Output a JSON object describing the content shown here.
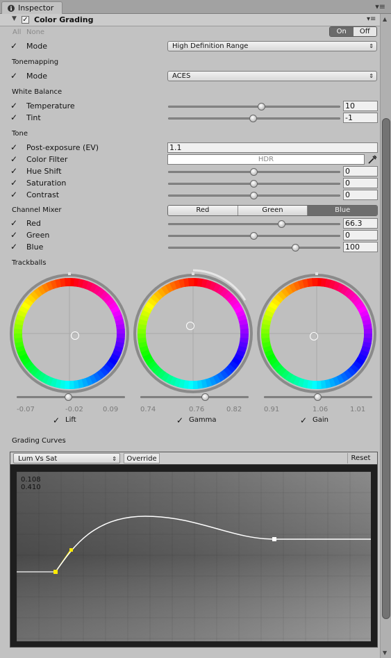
{
  "tab": {
    "title": "Inspector",
    "icon": "info-icon",
    "menu_icon": "▾≡"
  },
  "header": {
    "title": "Color Grading",
    "menu_icon": "▾≡"
  },
  "toggle_row": {
    "all": "All",
    "none": "None",
    "on": "On",
    "off": "Off"
  },
  "mode": {
    "label": "Mode",
    "value": "High Definition Range"
  },
  "tonemapping": {
    "section": "Tonemapping",
    "label": "Mode",
    "value": "ACES"
  },
  "white_balance": {
    "section": "White Balance",
    "temperature": {
      "label": "Temperature",
      "value": "10",
      "fraction": 0.545
    },
    "tint": {
      "label": "Tint",
      "value": "-1",
      "fraction": 0.495
    }
  },
  "tone": {
    "section": "Tone",
    "post_exposure": {
      "label": "Post-exposure (EV)",
      "value": "1.1"
    },
    "color_filter": {
      "label": "Color Filter",
      "value": "HDR"
    },
    "hue_shift": {
      "label": "Hue Shift",
      "value": "0",
      "fraction": 0.5
    },
    "saturation": {
      "label": "Saturation",
      "value": "0",
      "fraction": 0.5
    },
    "contrast": {
      "label": "Contrast",
      "value": "0",
      "fraction": 0.5
    }
  },
  "channel_mixer": {
    "section": "Channel Mixer",
    "tabs": [
      "Red",
      "Green",
      "Blue"
    ],
    "selected": "Blue",
    "red": {
      "label": "Red",
      "value": "66.3",
      "fraction": 0.66
    },
    "green": {
      "label": "Green",
      "value": "0",
      "fraction": 0.5
    },
    "blue": {
      "label": "Blue",
      "value": "100",
      "fraction": 0.74
    }
  },
  "trackballs": {
    "section": "Trackballs",
    "items": [
      {
        "label": "Lift",
        "ticks": [
          "-0.07",
          "-0.02",
          "0.09"
        ],
        "fraction": 0.48
      },
      {
        "label": "Gamma",
        "ticks": [
          "0.74",
          "0.76",
          "0.82"
        ],
        "fraction": 0.6
      },
      {
        "label": "Gain",
        "ticks": [
          "0.91",
          "1.06",
          "1.01"
        ],
        "fraction": 0.5
      }
    ]
  },
  "grading_curves": {
    "section": "Grading Curves",
    "dropdown": "Lum Vs Sat",
    "override": "Override",
    "reset": "Reset",
    "readout": [
      "0.108",
      "0.410"
    ]
  },
  "colors": {
    "accent": "#6b6b6b",
    "selected_point": "#ffea00"
  }
}
